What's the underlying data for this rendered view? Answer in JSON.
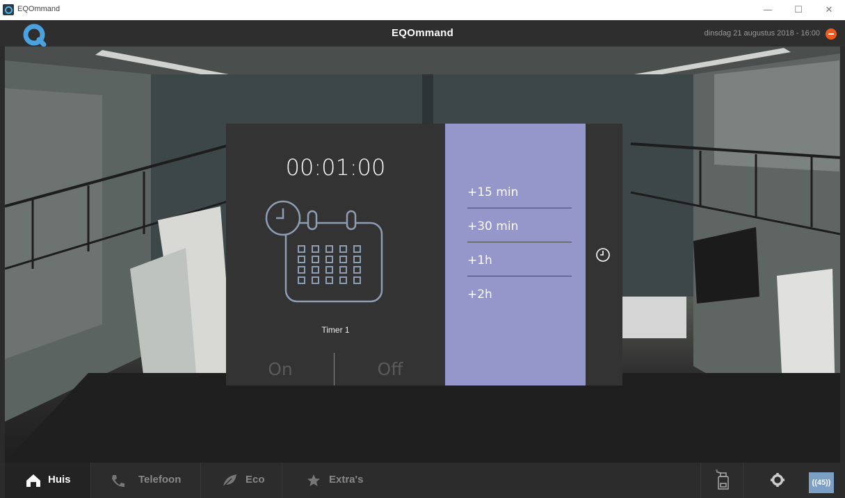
{
  "window": {
    "title": "EQOmmand",
    "minimize": "—",
    "maximize": "☐",
    "close": "✕"
  },
  "header": {
    "title": "EQOmmand",
    "datetime": "dinsdag 21 augustus 2018 - 16:00"
  },
  "timer": {
    "time": "00:01:00",
    "name": "Timer 1",
    "on_label": "On",
    "off_label": "Off"
  },
  "options": [
    "+15 min",
    "+30 min",
    "+1h",
    "+2h"
  ],
  "nav": [
    {
      "label": "Huis",
      "icon": "home-icon",
      "active": true
    },
    {
      "label": "Telefoon",
      "icon": "phone-icon",
      "active": false
    },
    {
      "label": "Eco",
      "icon": "leaf-icon",
      "active": false
    },
    {
      "label": "Extra's",
      "icon": "star-icon",
      "active": false
    }
  ],
  "badge": "((45))",
  "colors": {
    "accent": "#9596c9",
    "stop": "#ef5a1f",
    "logo": "#4aa3df",
    "badge": "#7b9fc5"
  }
}
